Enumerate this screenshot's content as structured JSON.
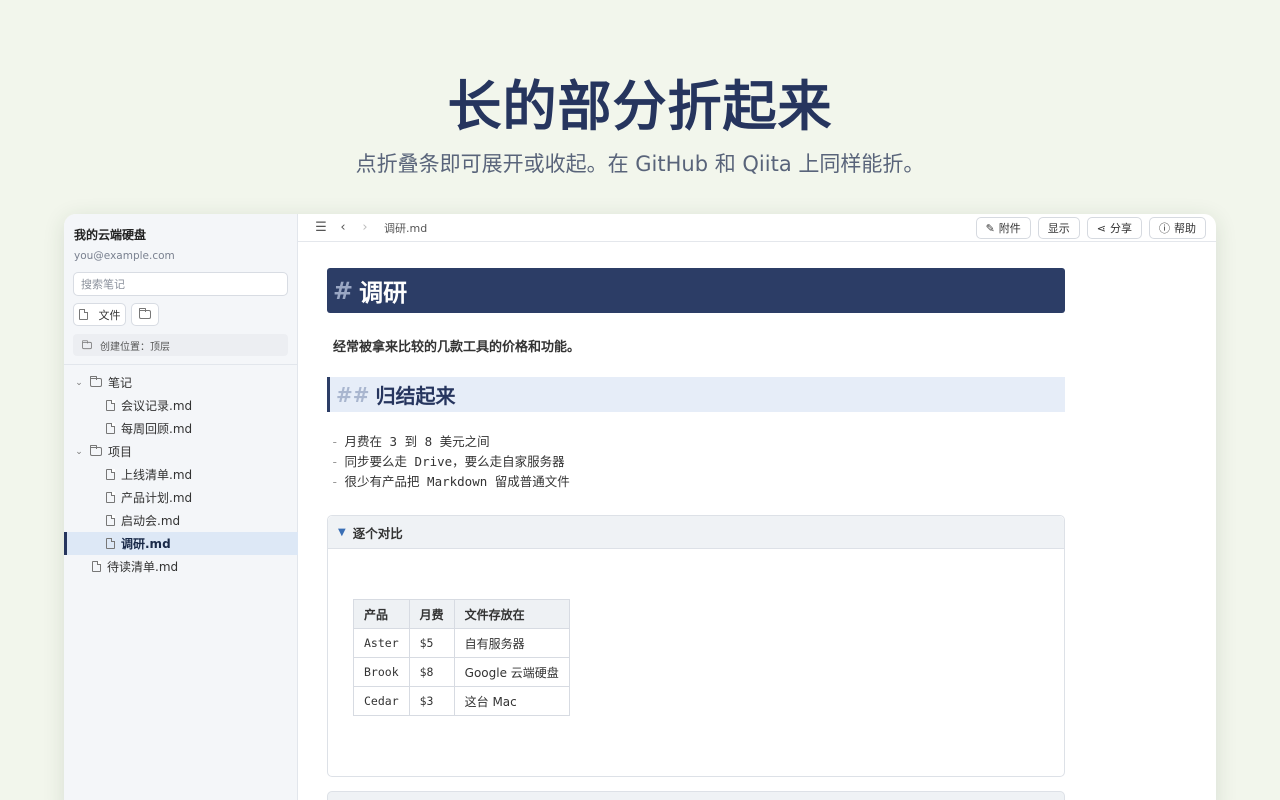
{
  "hero": {
    "title": "长的部分折起来",
    "subtitle": "点折叠条即可展开或收起。在 GitHub 和 Qiita 上同样能折。"
  },
  "sidebar": {
    "account_name": "我的云端硬盘",
    "account_email": "you@example.com",
    "search_placeholder": "搜索笔记",
    "new_file_label": "文件",
    "location_text": "创建位置：顶层",
    "tree": [
      {
        "type": "folder",
        "label": "笔记",
        "depth": 0
      },
      {
        "type": "file",
        "label": "会议记录.md",
        "depth": 1
      },
      {
        "type": "file",
        "label": "每周回顾.md",
        "depth": 1
      },
      {
        "type": "folder",
        "label": "项目",
        "depth": 0
      },
      {
        "type": "file",
        "label": "上线清单.md",
        "depth": 1
      },
      {
        "type": "file",
        "label": "产品计划.md",
        "depth": 1
      },
      {
        "type": "file",
        "label": "启动会.md",
        "depth": 1
      },
      {
        "type": "file",
        "label": "调研.md",
        "depth": 1,
        "active": true
      },
      {
        "type": "file",
        "label": "待读清单.md",
        "depth": 0
      }
    ]
  },
  "topbar": {
    "breadcrumb": "调研.md",
    "attach_label": "附件",
    "display_label": "显示",
    "share_label": "分享",
    "help_label": "帮助"
  },
  "doc": {
    "h1_hash": "#",
    "h1": "调研",
    "intro": "经常被拿来比较的几款工具的价格和功能。",
    "h2_hash": "##",
    "h2": "归结起来",
    "list_dash": "-",
    "list": [
      "月费在 3 到 8 美元之间",
      "同步要么走 Drive，要么走自家服务器",
      "很少有产品把 Markdown 留成普通文件"
    ],
    "details_summary": "逐个对比",
    "table": {
      "headers": [
        "产品",
        "月费",
        "文件存放在"
      ],
      "rows": [
        [
          "Aster",
          "$5",
          "自有服务器"
        ],
        [
          "Brook",
          "$8",
          "Google 云端硬盘"
        ],
        [
          "Cedar",
          "$3",
          "这台 Mac"
        ]
      ]
    }
  }
}
